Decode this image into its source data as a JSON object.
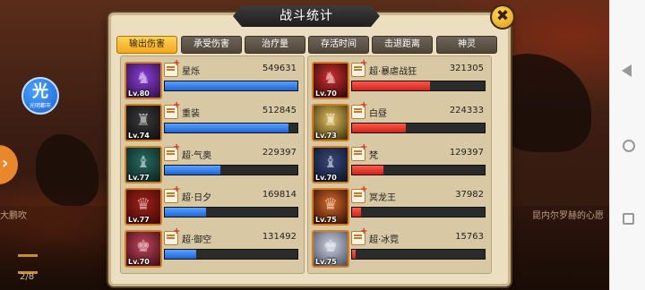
{
  "background": {
    "left_text": "大鹏吹",
    "right_text": "昆内尔罗赫的心愿",
    "counter": "2/8",
    "float_icon_glyph": "光",
    "float_icon_caption": "光明都市"
  },
  "panel": {
    "title": "战斗统计",
    "close_glyph": "✖",
    "tabs": [
      {
        "label": "输出伤害",
        "active": true
      },
      {
        "label": "承受伤害",
        "active": false
      },
      {
        "label": "治疗量",
        "active": false
      },
      {
        "label": "存活时间",
        "active": false
      },
      {
        "label": "击退距离",
        "active": false
      },
      {
        "label": "神灵",
        "active": false
      }
    ]
  },
  "colors": {
    "left_bar": "#1f63d6",
    "right_bar": "#d0221a",
    "active_tab": "#f2a81c"
  },
  "left_team": [
    {
      "name": "星烁",
      "value": "549631",
      "level": "Lv.80",
      "share": 1.0,
      "portrait": "purple"
    },
    {
      "name": "重装",
      "value": "512845",
      "level": "Lv.74",
      "share": 0.933,
      "portrait": "dark"
    },
    {
      "name": "超·气奥",
      "value": "229397",
      "level": "Lv.77",
      "share": 0.417,
      "portrait": "teal"
    },
    {
      "name": "超·日夕",
      "value": "169814",
      "level": "Lv.77",
      "share": 0.309,
      "portrait": "red"
    },
    {
      "name": "超·御空",
      "value": "131492",
      "level": "Lv.70",
      "share": 0.239,
      "portrait": "rose"
    }
  ],
  "right_team": [
    {
      "name": "超·暴虐战狂",
      "value": "321305",
      "level": "Lv.70",
      "share": 0.585,
      "portrait": "crimson"
    },
    {
      "name": "白昼",
      "value": "224333",
      "level": "Lv.73",
      "share": 0.408,
      "portrait": "gold"
    },
    {
      "name": "梵",
      "value": "129397",
      "level": "Lv.70",
      "share": 0.235,
      "portrait": "navy"
    },
    {
      "name": "冥龙王",
      "value": "37982",
      "level": "Lv.75",
      "share": 0.069,
      "portrait": "ember"
    },
    {
      "name": "超·冰霓",
      "value": "15763",
      "level": "Lv.75",
      "share": 0.029,
      "portrait": "frost"
    }
  ]
}
